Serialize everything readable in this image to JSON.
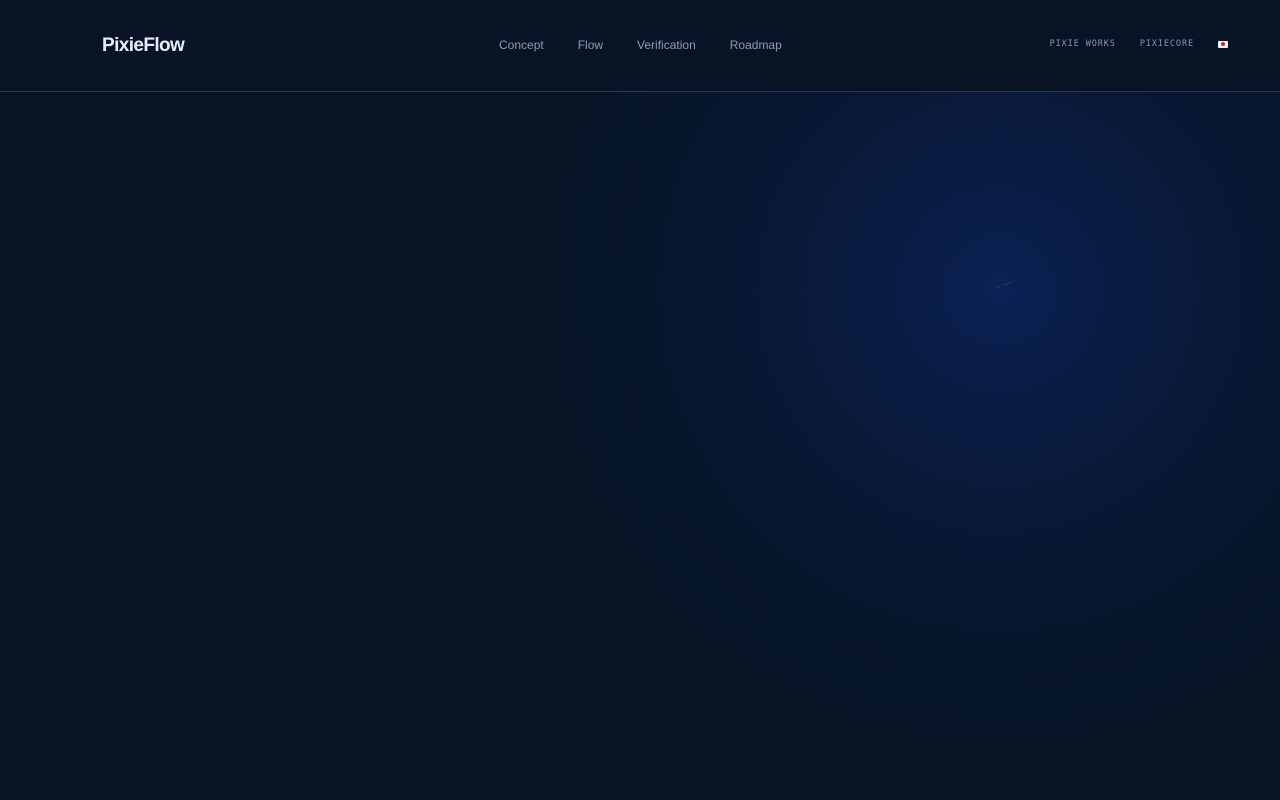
{
  "header": {
    "logo": "PixieFlow",
    "nav": [
      "Concept",
      "Flow",
      "Verification",
      "Roadmap"
    ],
    "links": [
      "PIXIE WORKS",
      "PIXIECORE"
    ],
    "language_icon": "japan-flag-icon"
  },
  "colors": {
    "background": "#071425",
    "header_background": "#081426",
    "glow": "#0c2258",
    "logo_text": "#e7ecf4",
    "nav_text": "#8c9bb2"
  }
}
